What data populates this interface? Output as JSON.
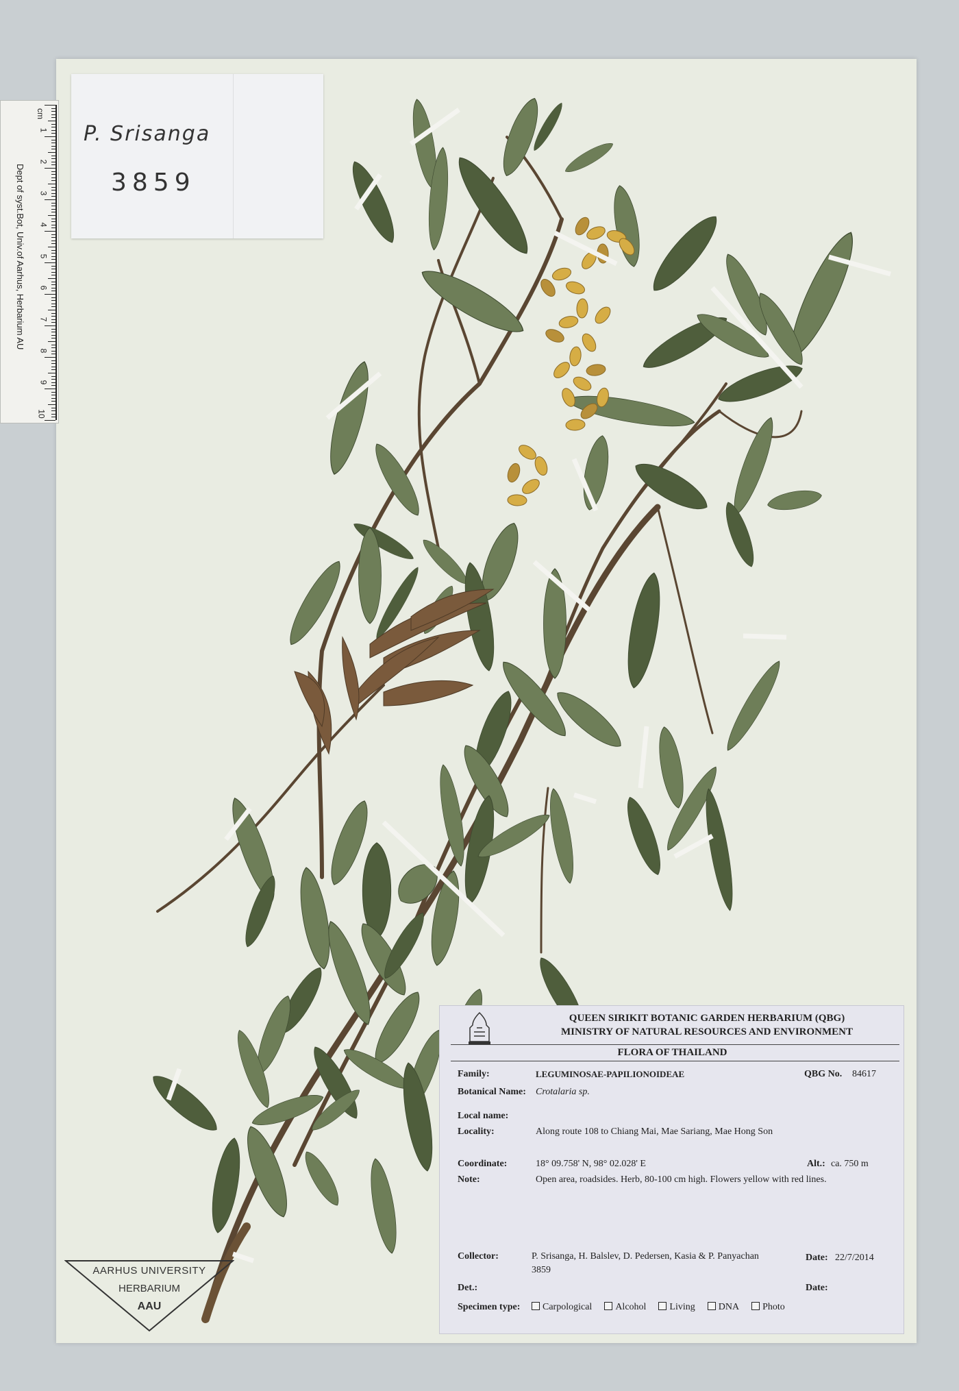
{
  "ruler": {
    "unit": "cm",
    "numbers": [
      "1",
      "2",
      "3",
      "4",
      "5",
      "6",
      "7",
      "8",
      "9",
      "10"
    ],
    "text": "Dept of syst.Bot, Univ.of Aarhus, Herbarium AU"
  },
  "collector_tag": {
    "name": "P. Srisanga",
    "number": "3859"
  },
  "stamp": {
    "line1": "AARHUS UNIVERSITY",
    "line2": "HERBARIUM",
    "line3": "AAU"
  },
  "label": {
    "header1": "QUEEN SIRIKIT BOTANIC GARDEN HERBARIUM (QBG)",
    "header2": "MINISTRY OF NATURAL RESOURCES AND ENVIRONMENT",
    "flora": "FLORA OF THAILAND",
    "family_label": "Family:",
    "family": "LEGUMINOSAE-PAPILIONOIDEAE",
    "qbg_label": "QBG No.",
    "qbg": "84617",
    "botanical_label": "Botanical Name:",
    "botanical": "Crotalaria sp.",
    "local_label": "Local name:",
    "local": "",
    "locality_label": "Locality:",
    "locality": "Along route 108 to Chiang Mai,  Mae Sariang, Mae Hong Son",
    "coordinate_label": "Coordinate:",
    "coordinate": "18° 09.758' N, 98° 02.028' E",
    "alt_label": "Alt.:",
    "alt": "ca. 750 m",
    "note_label": "Note:",
    "note": "Open area, roadsides.  Herb, 80-100 cm high.  Flowers yellow with red lines.",
    "collector_label": "Collector:",
    "collector_line1": "P. Srisanga, H. Balslev, D. Pedersen, Kasia & P. Panyachan",
    "collector_line2": "3859",
    "date_label": "Date:",
    "date": "22/7/2014",
    "det_label": "Det.:",
    "det": "",
    "date2_label": "Date:",
    "specimen_label": "Specimen type:",
    "specimen_types": [
      "Carpological",
      "Alcohol",
      "Living",
      "DNA",
      "Photo"
    ]
  },
  "colors": {
    "background": "#c9cfd2",
    "sheet": "#e9ece2",
    "leaf": "#6e7e58",
    "leaf_dark": "#4f5e3c",
    "stem": "#5a4632",
    "flower": "#d6ad45"
  }
}
